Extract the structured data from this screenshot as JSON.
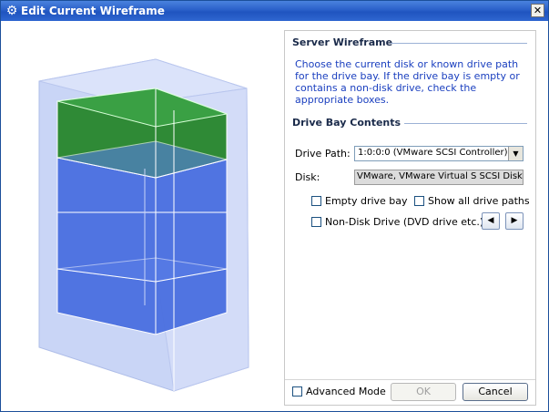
{
  "window": {
    "title": "Edit Current Wireframe",
    "close_label": "✕",
    "icon": "gear-icon"
  },
  "server_wireframe": {
    "title": "Server Wireframe",
    "description": "Choose the current disk or known drive path for the drive bay. If the drive bay is empty or contains a non-disk drive, check the appropriate boxes."
  },
  "drive_bay": {
    "title": "Drive Bay Contents",
    "drive_path_label": "Drive Path:",
    "drive_path_value": "1:0:0:0 (VMware SCSI Controller)",
    "disk_label": "Disk:",
    "disk_value": "VMware, VMware Virtual S SCSI Disk D",
    "empty_drive_bay": "Empty drive bay",
    "show_all_drive_paths": "Show all drive paths",
    "non_disk_drive": "Non-Disk Drive (DVD drive etc.)",
    "prev_icon": "left-arrow-icon",
    "next_icon": "right-arrow-icon"
  },
  "footer": {
    "advanced_mode": "Advanced Mode",
    "ok": "OK",
    "cancel": "Cancel"
  },
  "colors": {
    "titlebar": "#245edb",
    "selected_bay": "#2e8b3a",
    "bays": "#4a6fe0",
    "chassis": "#c7d3f5"
  }
}
